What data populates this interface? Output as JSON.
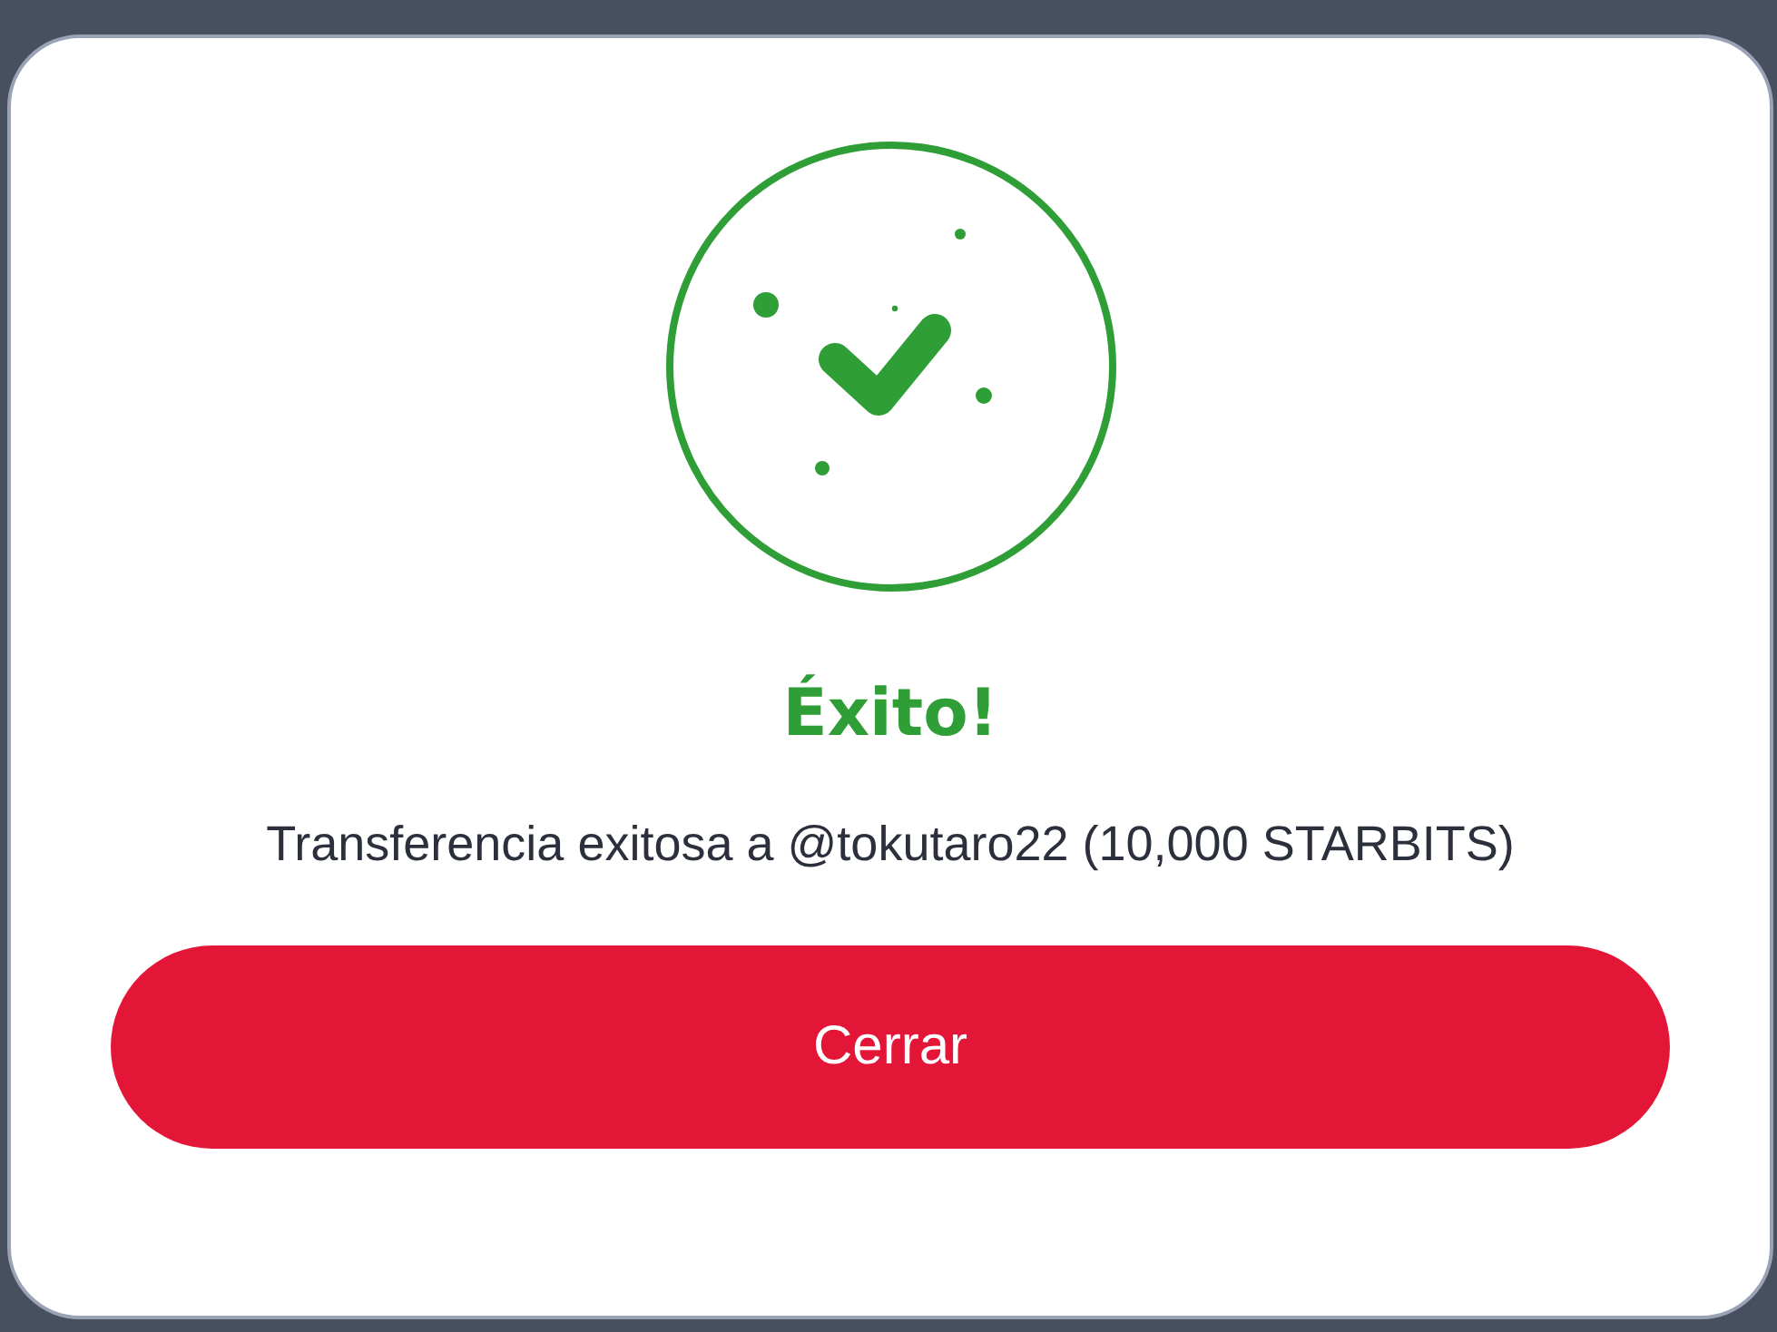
{
  "dialog": {
    "success": true,
    "title": "Éxito!",
    "message": "Transferencia exitosa a @tokutaro22 (10,000 STARBITS)",
    "button": "Cerrar"
  }
}
